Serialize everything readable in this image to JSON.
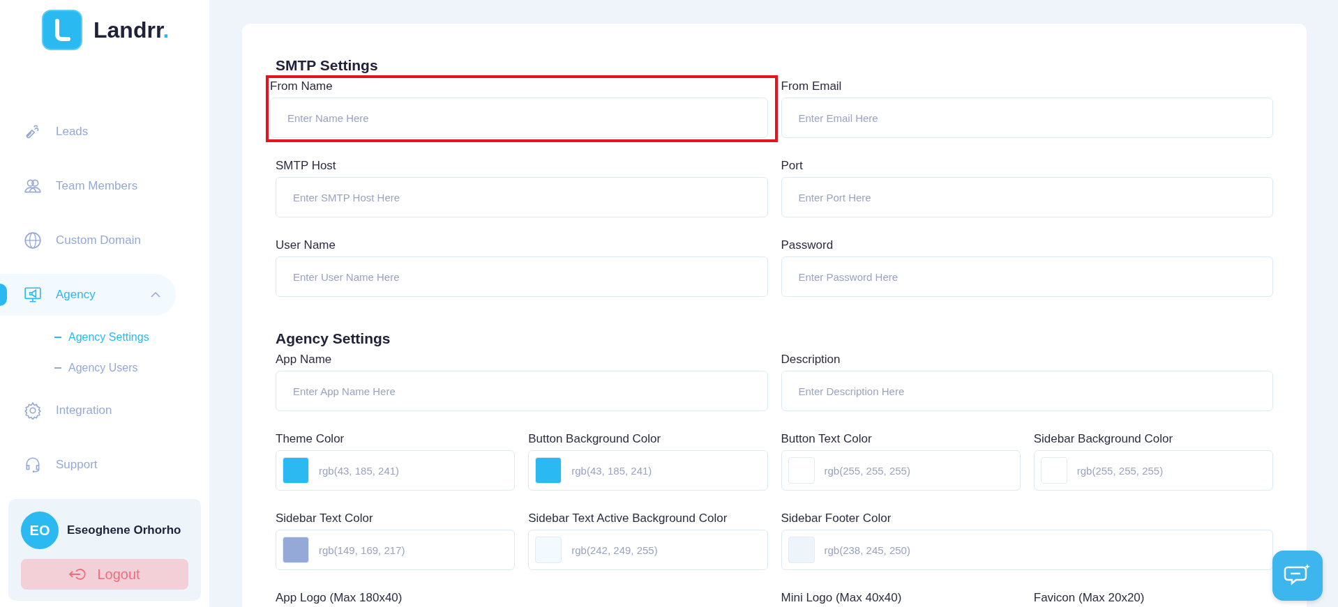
{
  "sidebar": {
    "brand": {
      "name": "Landrr",
      "dot": "."
    },
    "nav": [
      {
        "label": "Leads",
        "selected": false
      },
      {
        "label": "Team Members",
        "selected": false
      },
      {
        "label": "Custom Domain",
        "selected": false
      },
      {
        "label": "Agency",
        "selected": true,
        "expanded": true,
        "children": [
          {
            "label": "Agency Settings",
            "selected": true
          },
          {
            "label": "Agency Users",
            "selected": false
          }
        ]
      },
      {
        "label": "Integration",
        "selected": false
      },
      {
        "label": "Support",
        "selected": false
      }
    ],
    "user": {
      "initials": "EO",
      "name": "Eseoghene Orhorho",
      "logout": "Logout"
    }
  },
  "sections": [
    {
      "title": "SMTP Settings",
      "fields": [
        {
          "kind": "text",
          "label": "From Name",
          "placeholder": "Enter Name Here",
          "highlighted": true
        },
        {
          "kind": "text",
          "label": "From Email",
          "placeholder": "Enter Email Here",
          "highlighted": false
        },
        {
          "kind": "text",
          "label": "SMTP Host",
          "placeholder": "Enter SMTP Host Here",
          "highlighted": false
        },
        {
          "kind": "text",
          "label": "Port",
          "placeholder": "Enter Port Here",
          "highlighted": false
        },
        {
          "kind": "text",
          "label": "User Name",
          "placeholder": "Enter User Name Here",
          "highlighted": false
        },
        {
          "kind": "text",
          "label": "Password",
          "placeholder": "Enter Password Here",
          "highlighted": false
        }
      ]
    },
    {
      "title": "Agency Settings",
      "fields": [
        {
          "kind": "text",
          "label": "App Name",
          "placeholder": "Enter App Name Here",
          "highlighted": false
        },
        {
          "kind": "text",
          "label": "Description",
          "placeholder": "Enter Description Here",
          "highlighted": false
        },
        {
          "kind": "color",
          "label": "Theme Color",
          "value": "rgb(43, 185, 241)",
          "color": "#2bb9f1"
        },
        {
          "kind": "color",
          "label": "Button Background Color",
          "value": "rgb(43, 185, 241)",
          "color": "#2bb9f1"
        },
        {
          "kind": "color",
          "label": "Button Text Color",
          "value": "rgb(255, 255, 255)",
          "color": "#ffffff"
        },
        {
          "kind": "color",
          "label": "Sidebar Background Color",
          "value": "rgb(255, 255, 255)",
          "color": "#ffffff"
        },
        {
          "kind": "color",
          "label": "Sidebar Text Color",
          "value": "rgb(149, 169, 217)",
          "color": "#95a9d9"
        },
        {
          "kind": "color",
          "label": "Sidebar Text Active Background Color",
          "value": "rgb(242, 249, 255)",
          "color": "#f2f9ff"
        },
        {
          "kind": "color",
          "label": "Sidebar Footer Color",
          "value": "rgb(238, 245, 250)",
          "color": "#eef5fa"
        },
        {
          "kind": "upload",
          "label": "App Logo (Max 180x40)"
        },
        {
          "kind": "upload",
          "label": "Mini Logo (Max 40x40)"
        },
        {
          "kind": "upload",
          "label": "Favicon (Max 20x20)"
        }
      ]
    }
  ]
}
